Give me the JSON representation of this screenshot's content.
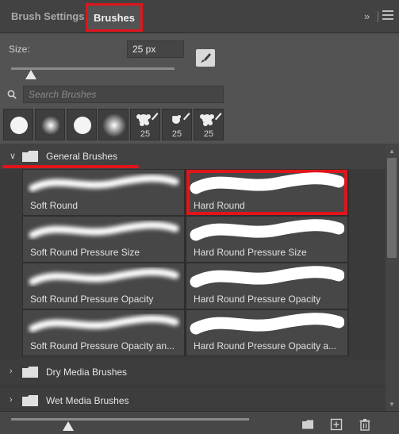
{
  "tabs": {
    "inactive_label": "Brush Settings",
    "active_label": "Brushes",
    "collapse_glyph": "»",
    "menu_icon": "hamburger-menu-icon"
  },
  "size": {
    "label": "Size:",
    "value": "25 px",
    "slider_level": 0.12
  },
  "search": {
    "placeholder": "Search Brushes",
    "value": ""
  },
  "recent_brushes": [
    {
      "kind": "hard-round",
      "size": ""
    },
    {
      "kind": "soft-round",
      "size": ""
    },
    {
      "kind": "hard-round",
      "size": ""
    },
    {
      "kind": "soft-round-large",
      "size": ""
    },
    {
      "kind": "splatter",
      "size": "25"
    },
    {
      "kind": "splatter-small",
      "size": "25"
    },
    {
      "kind": "splatter",
      "size": "25"
    }
  ],
  "groups": [
    {
      "name": "General Brushes",
      "expanded": true,
      "brushes": [
        {
          "name": "Soft Round",
          "type": "soft",
          "selected": false
        },
        {
          "name": "Hard Round",
          "type": "hard",
          "selected": true
        },
        {
          "name": "Soft Round Pressure Size",
          "type": "soft",
          "selected": false
        },
        {
          "name": "Hard Round Pressure Size",
          "type": "hard",
          "selected": false
        },
        {
          "name": "Soft Round Pressure Opacity",
          "type": "soft",
          "selected": false
        },
        {
          "name": "Hard Round Pressure Opacity",
          "type": "hard",
          "selected": false
        },
        {
          "name": "Soft Round Pressure Opacity an...",
          "type": "soft",
          "selected": false
        },
        {
          "name": "Hard Round Pressure Opacity a...",
          "type": "hard",
          "selected": false
        }
      ]
    },
    {
      "name": "Dry Media Brushes",
      "expanded": false
    },
    {
      "name": "Wet Media Brushes",
      "expanded": false
    }
  ],
  "bottom": {
    "preview_level": 0.24,
    "icons": [
      "new-group-folder-icon",
      "new-brush-icon",
      "delete-trash-icon"
    ]
  },
  "colors": {
    "highlight": "#e0151b",
    "panel": "#535353",
    "list_bg": "#3a3a3a"
  }
}
